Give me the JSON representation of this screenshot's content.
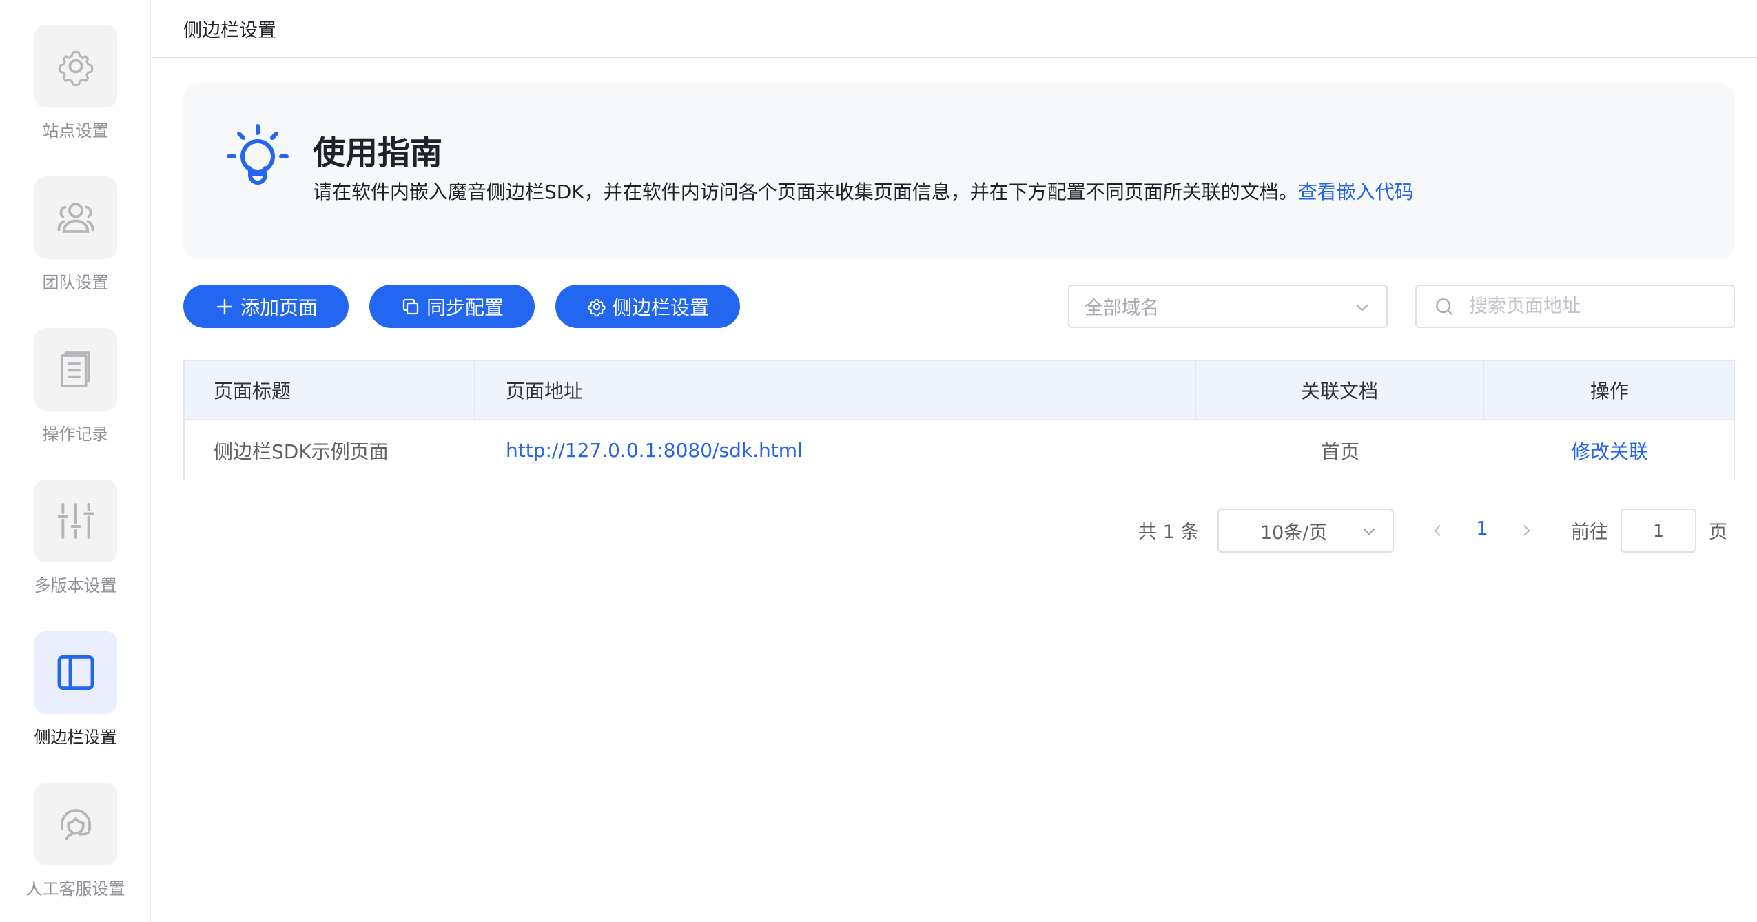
{
  "sidebar": {
    "items": [
      {
        "label": "站点设置",
        "icon": "gear-icon",
        "active": false
      },
      {
        "label": "团队设置",
        "icon": "team-icon",
        "active": false
      },
      {
        "label": "操作记录",
        "icon": "document-icon",
        "active": false
      },
      {
        "label": "多版本设置",
        "icon": "sliders-icon",
        "active": false
      },
      {
        "label": "侧边栏设置",
        "icon": "sidebar-layout-icon",
        "active": true
      },
      {
        "label": "人工客服设置",
        "icon": "headset-icon",
        "active": false
      }
    ]
  },
  "header": {
    "title": "侧边栏设置"
  },
  "guide": {
    "title": "使用指南",
    "description": "请在软件内嵌入魔音侧边栏SDK，并在软件内访问各个页面来收集页面信息，并在下方配置不同页面所关联的文档。",
    "link": "查看嵌入代码"
  },
  "toolbar": {
    "add_label": "添加页面",
    "sync_label": "同步配置",
    "sidebar_label": "侧边栏设置",
    "domain_placeholder": "全部域名",
    "search_placeholder": "搜索页面地址"
  },
  "table": {
    "headers": [
      "页面标题",
      "页面地址",
      "关联文档",
      "操作"
    ],
    "rows": [
      {
        "title": "侧边栏SDK示例页面",
        "url": "http://127.0.0.1:8080/sdk.html",
        "doc": "首页",
        "action": "修改关联"
      }
    ]
  },
  "pagination": {
    "total": "共 1 条",
    "page_size": "10条/页",
    "current_page": "1",
    "goto_label": "前往",
    "goto_value": "1",
    "page_suffix": "页"
  },
  "colors": {
    "primary": "#2366f0",
    "link": "#2563eb",
    "active_tile": "#e9effe"
  }
}
